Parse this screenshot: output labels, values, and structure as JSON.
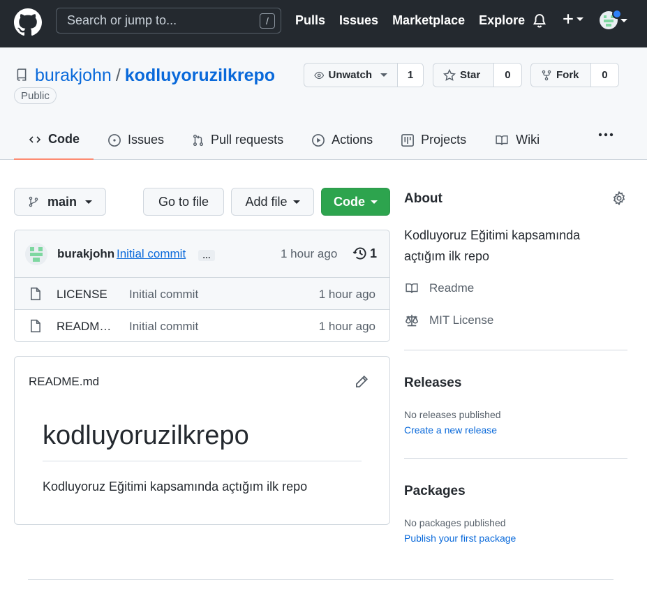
{
  "header": {
    "search_placeholder": "Search or jump to...",
    "search_key": "/",
    "nav": [
      "Pulls",
      "Issues",
      "Marketplace",
      "Explore"
    ]
  },
  "repo": {
    "owner": "burakjohn",
    "separator": "/",
    "name": "kodluyoruzilkrepo",
    "visibility": "Public",
    "watch_label": "Unwatch",
    "watch_count": "1",
    "star_label": "Star",
    "star_count": "0",
    "fork_label": "Fork",
    "fork_count": "0"
  },
  "tabs": [
    {
      "label": "Code",
      "icon": "code-icon"
    },
    {
      "label": "Issues",
      "icon": "issue-icon"
    },
    {
      "label": "Pull requests",
      "icon": "pull-request-icon"
    },
    {
      "label": "Actions",
      "icon": "play-icon"
    },
    {
      "label": "Projects",
      "icon": "project-icon"
    },
    {
      "label": "Wiki",
      "icon": "book-icon"
    }
  ],
  "toolbar": {
    "branch": "main",
    "go_to_file": "Go to file",
    "add_file": "Add file",
    "code": "Code"
  },
  "commit": {
    "author": "burakjohn",
    "message": "Initial commit",
    "ellipsis": "…",
    "time": "1 hour ago",
    "count": "1"
  },
  "files": [
    {
      "name": "LICENSE",
      "message": "Initial commit",
      "time": "1 hour ago"
    },
    {
      "name": "README.md",
      "message": "Initial commit",
      "time": "1 hour ago"
    }
  ],
  "readme": {
    "filename": "README.md",
    "heading": "kodluyoruzilkrepo",
    "body": "Kodluyoruz Eğitimi kapsamında açtığım ilk repo"
  },
  "about": {
    "title": "About",
    "description": "Kodluyoruz Eğitimi kapsamında açtığım ilk repo",
    "readme_link": "Readme",
    "license_link": "MIT License"
  },
  "releases": {
    "title": "Releases",
    "empty": "No releases published",
    "link": "Create a new release"
  },
  "packages": {
    "title": "Packages",
    "empty": "No packages published",
    "link": "Publish your first package"
  },
  "colors": {
    "header_bg": "#24292f",
    "link": "#0969da",
    "green": "#2da44e",
    "tab_underline": "#fd8c73"
  }
}
